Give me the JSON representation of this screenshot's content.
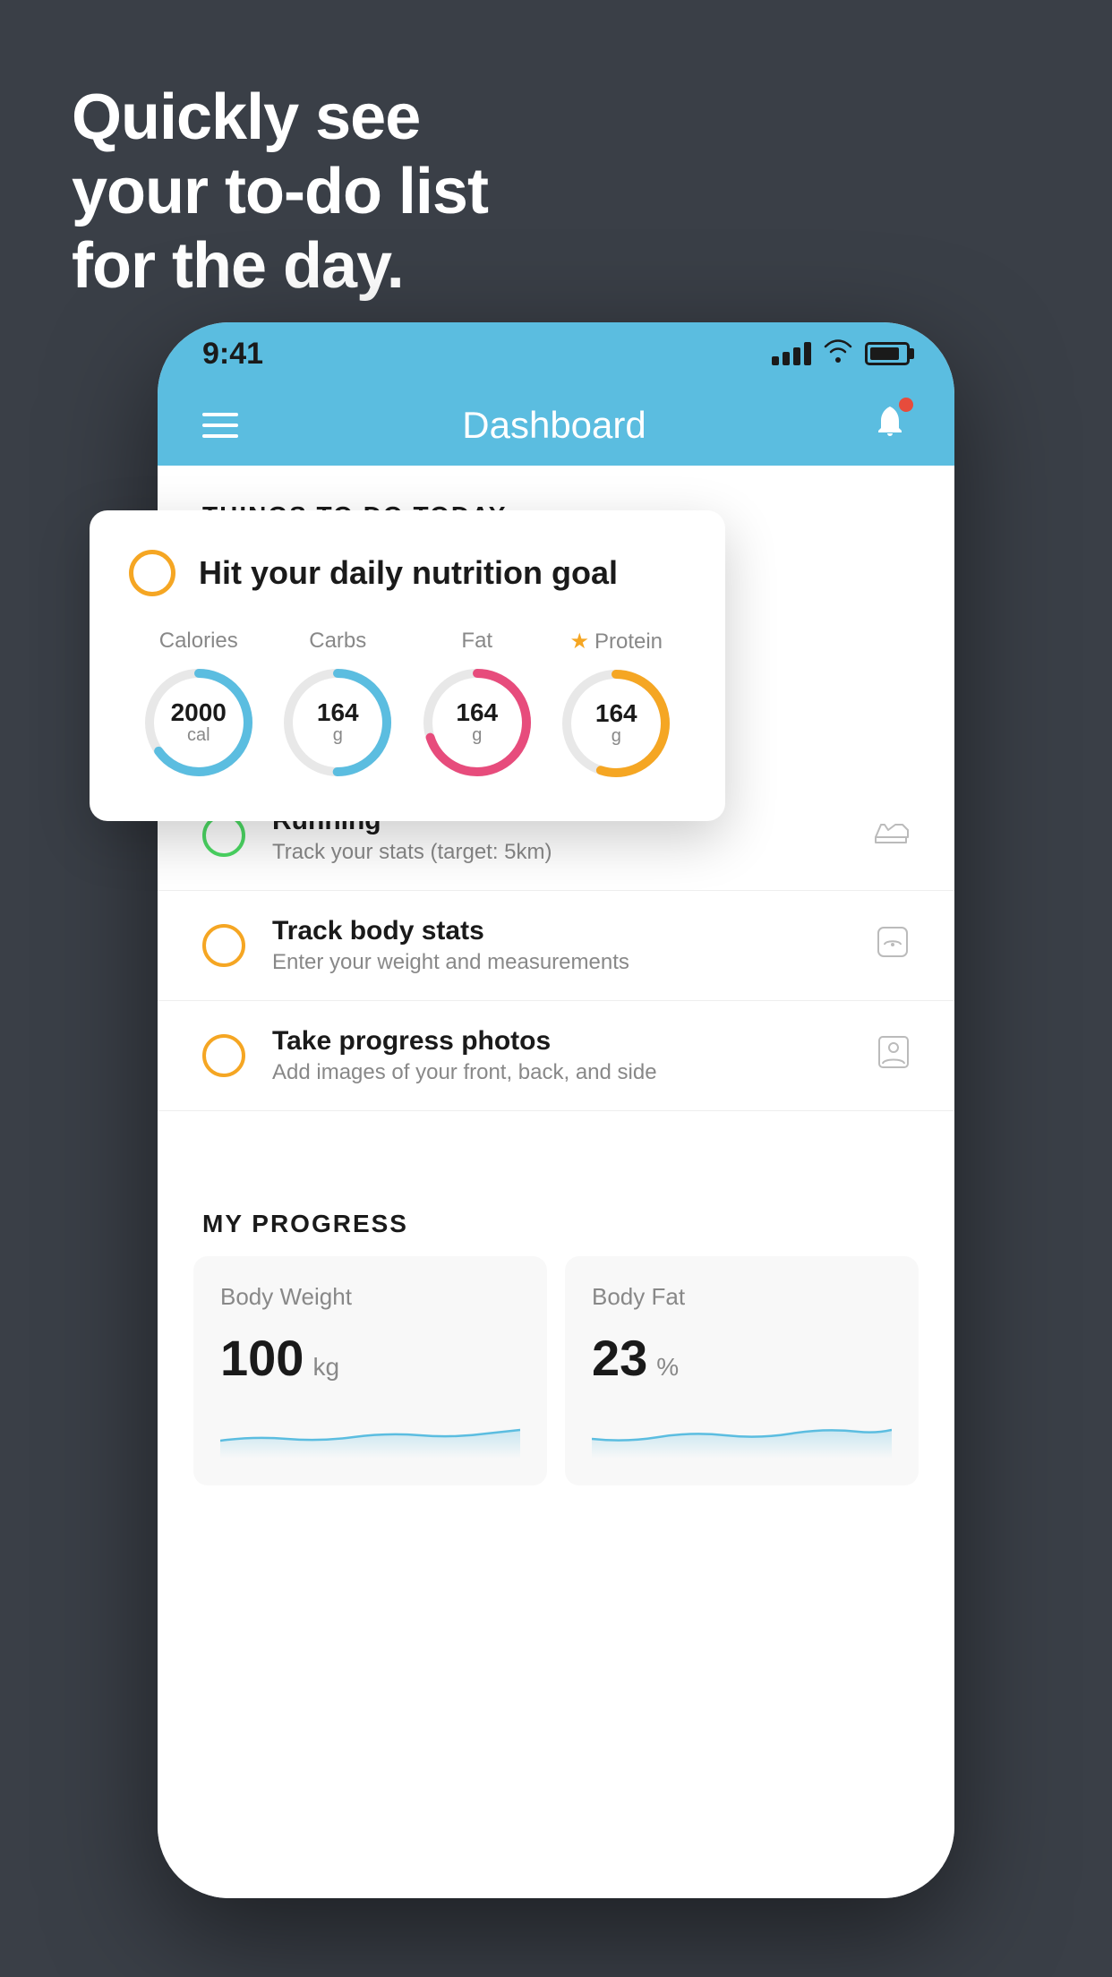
{
  "background": {
    "color": "#3a3f47"
  },
  "hero": {
    "line1": "Quickly see",
    "line2": "your to-do list",
    "line3": "for the day."
  },
  "statusBar": {
    "time": "9:41"
  },
  "navBar": {
    "title": "Dashboard"
  },
  "thingsToday": {
    "sectionLabel": "THINGS TO DO TODAY"
  },
  "nutritionCard": {
    "circleColor": "#f5a623",
    "title": "Hit your daily nutrition goal",
    "macros": [
      {
        "label": "Calories",
        "value": "2000",
        "unit": "cal",
        "color": "#5bbde0",
        "progress": 65,
        "hasStar": false
      },
      {
        "label": "Carbs",
        "value": "164",
        "unit": "g",
        "color": "#5bbde0",
        "progress": 50,
        "hasStar": false
      },
      {
        "label": "Fat",
        "value": "164",
        "unit": "g",
        "color": "#e74c7c",
        "progress": 70,
        "hasStar": false
      },
      {
        "label": "Protein",
        "value": "164",
        "unit": "g",
        "color": "#f5a623",
        "progress": 55,
        "hasStar": true
      }
    ]
  },
  "todoItems": [
    {
      "id": "running",
      "circleType": "green",
      "title": "Running",
      "subtitle": "Track your stats (target: 5km)",
      "icon": "shoe"
    },
    {
      "id": "body-stats",
      "circleType": "yellow",
      "title": "Track body stats",
      "subtitle": "Enter your weight and measurements",
      "icon": "scale"
    },
    {
      "id": "progress-photos",
      "circleType": "yellow",
      "title": "Take progress photos",
      "subtitle": "Add images of your front, back, and side",
      "icon": "person"
    }
  ],
  "progressSection": {
    "label": "MY PROGRESS",
    "cards": [
      {
        "title": "Body Weight",
        "value": "100",
        "unit": "kg"
      },
      {
        "title": "Body Fat",
        "value": "23",
        "unit": "%"
      }
    ]
  }
}
